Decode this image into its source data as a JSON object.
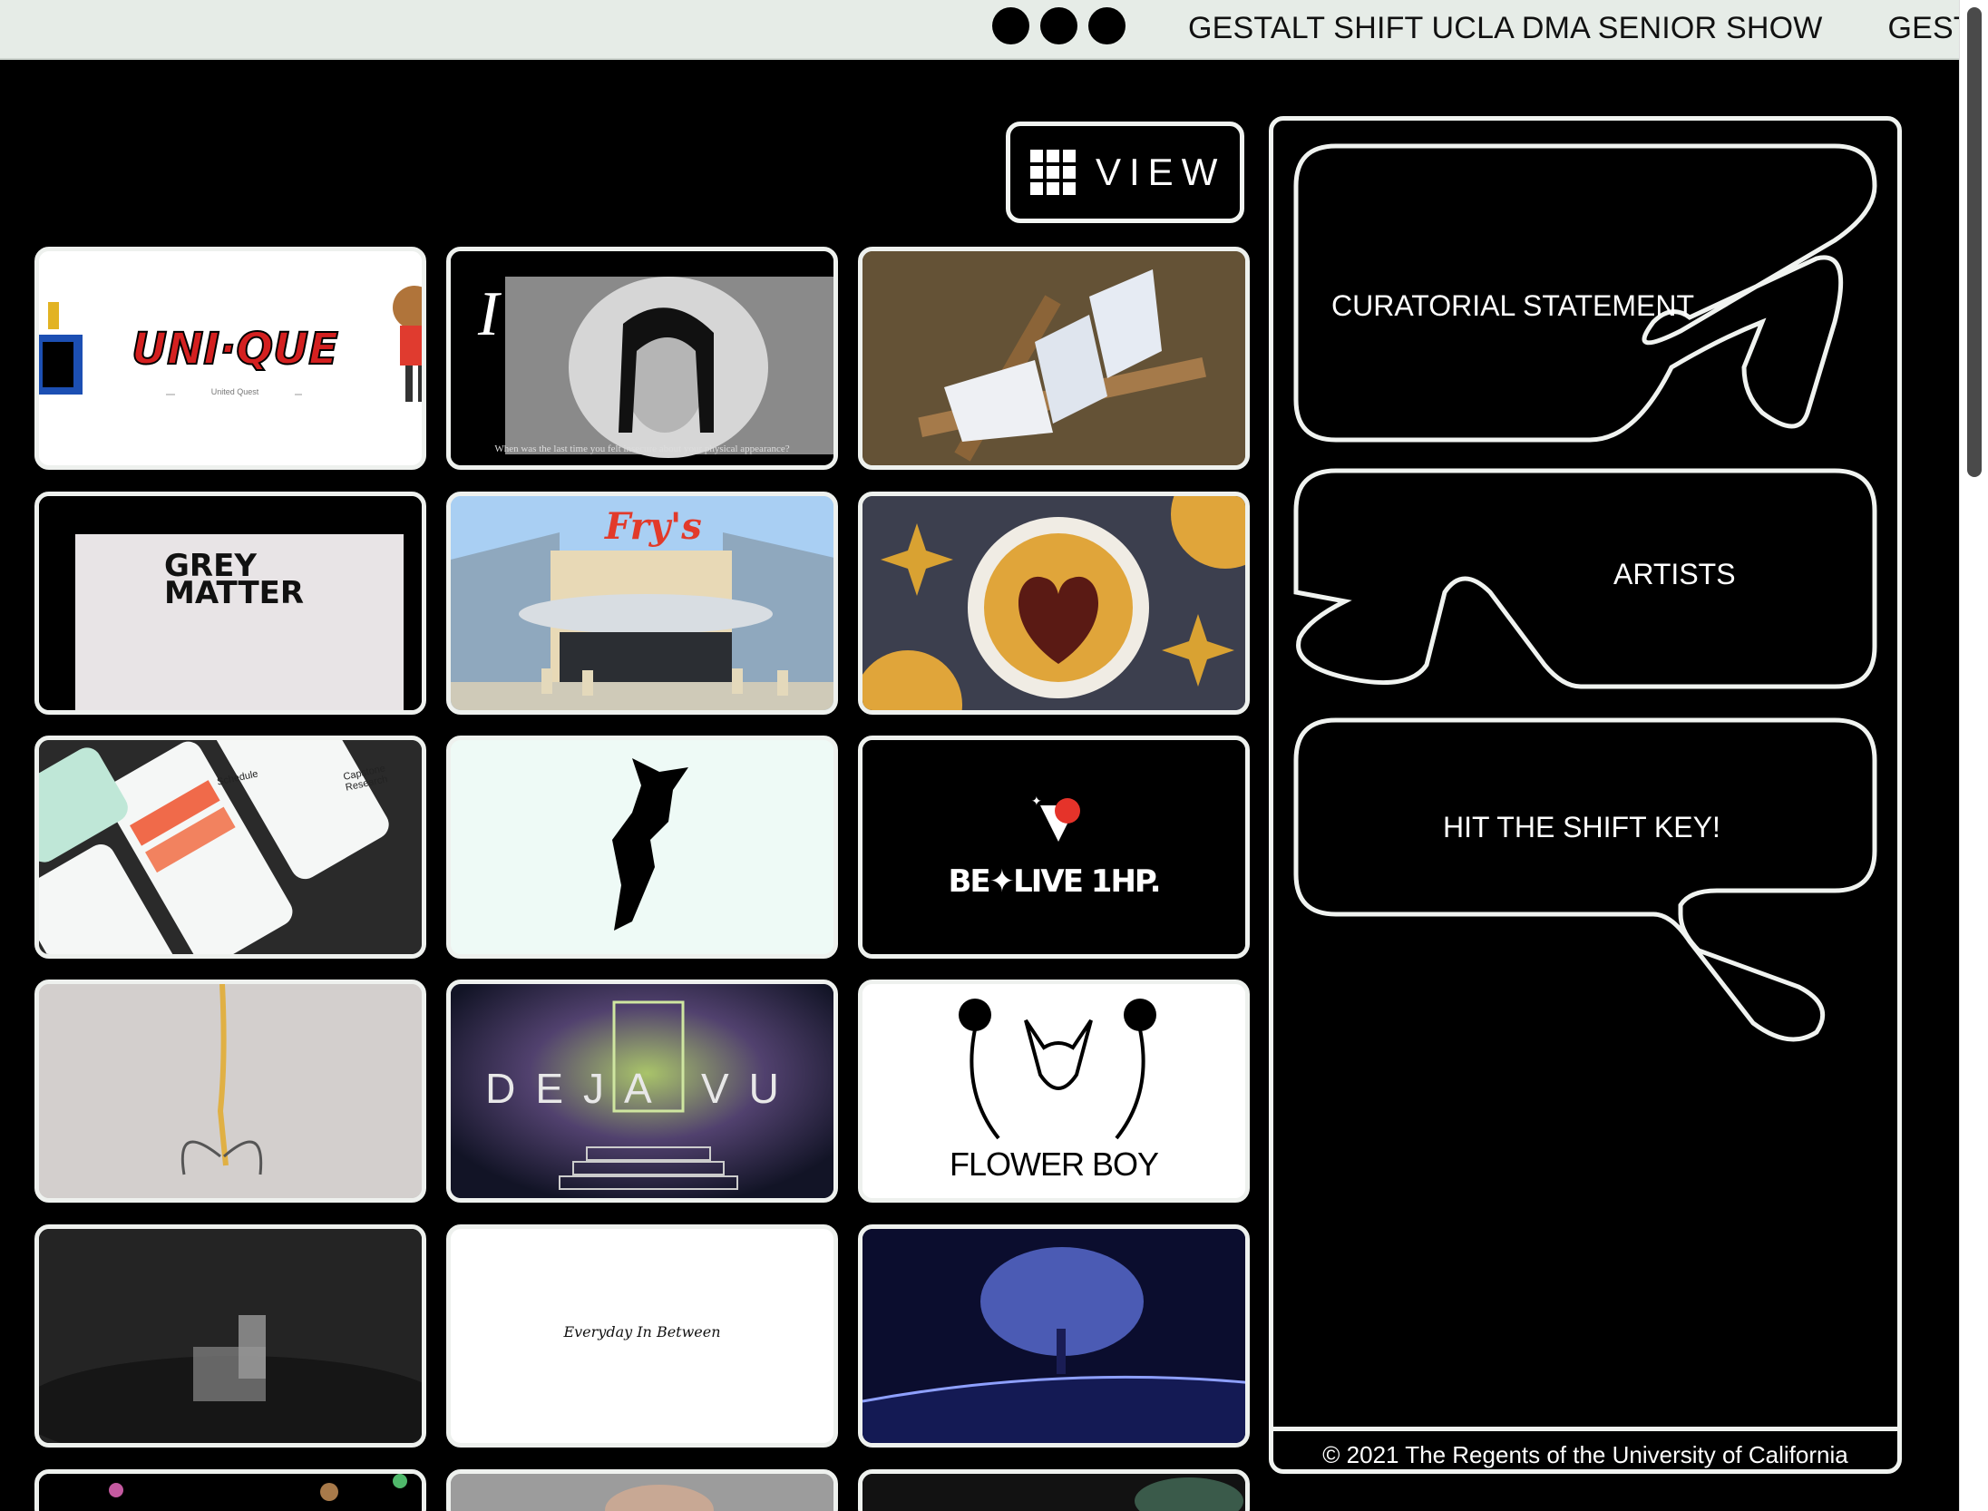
{
  "topbar": {
    "marquee": [
      "GESTALT SHIFT UCLA DMA SENIOR SHOW",
      "GESTALT SHIFT UCLA DMA SENIOR SHOW"
    ]
  },
  "view_button": {
    "label": "VIEW",
    "icon": "grid-icon"
  },
  "thumbnails": {
    "unique_title": "UNI·QUE",
    "unique_subtitle": "United Quest",
    "insecure_title": "I",
    "insecure_caption": "When was the last time you felt insecure about your physical appearance?",
    "greymatter_title": "GREY MATTER",
    "frys_sign": "Fry's",
    "capstone_label": "Capstone Research",
    "schedule_label": "Schedule",
    "belive_title": "BE✦LIVE 1HP.",
    "dejavu_title": "DEJA VU",
    "flowerboy_title": "FLOWER BOY",
    "everyday_title": "Everyday In Between"
  },
  "panel": {
    "curatorial_label": "CURATORIAL STATEMENT",
    "artists_label": "ARTISTS",
    "shift_label": "HIT THE SHIFT KEY!",
    "copyright": "© 2021 The Regents of the University of California"
  },
  "colors": {
    "bar_bg": "#e6ece7",
    "frame": "#f0f3f0",
    "page_bg": "#000000"
  }
}
